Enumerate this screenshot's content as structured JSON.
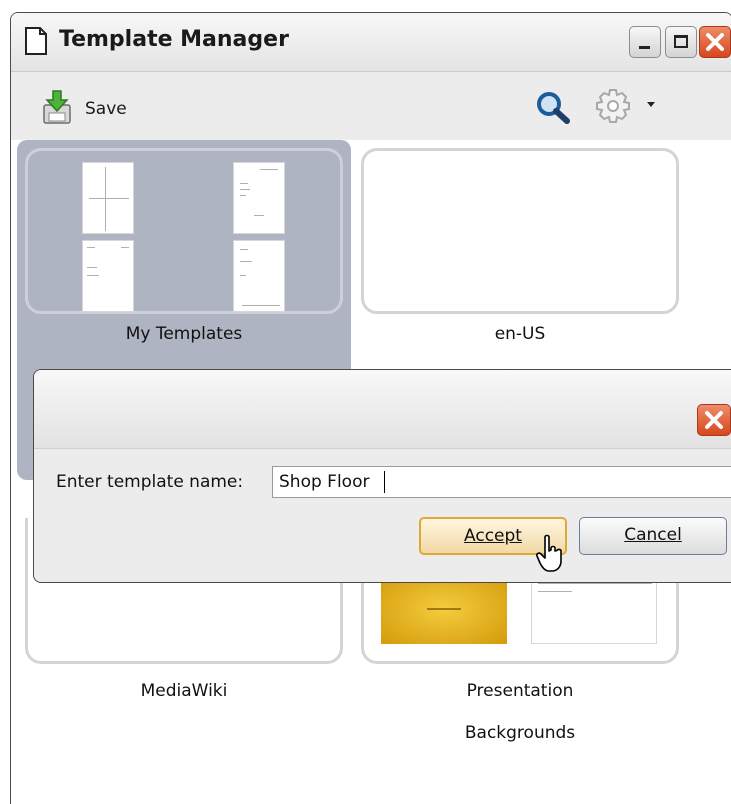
{
  "window": {
    "title": "Template Manager"
  },
  "toolbar": {
    "save_label": "Save"
  },
  "folders": {
    "my_templates": "My Templates",
    "en_us": "en-US",
    "mediawiki": "MediaWiki",
    "presentation_line1": "Presentation",
    "presentation_line2": "Backgrounds"
  },
  "dialog": {
    "label": "Enter template name:",
    "input_value": "Shop Floor",
    "accept_label": "Accept",
    "cancel_label": "Cancel"
  },
  "colors": {
    "selection": "#aeb4c2",
    "close_button": "#d8461d",
    "accept_border": "#e0a838",
    "presentation_thumb": "#e3b112"
  }
}
